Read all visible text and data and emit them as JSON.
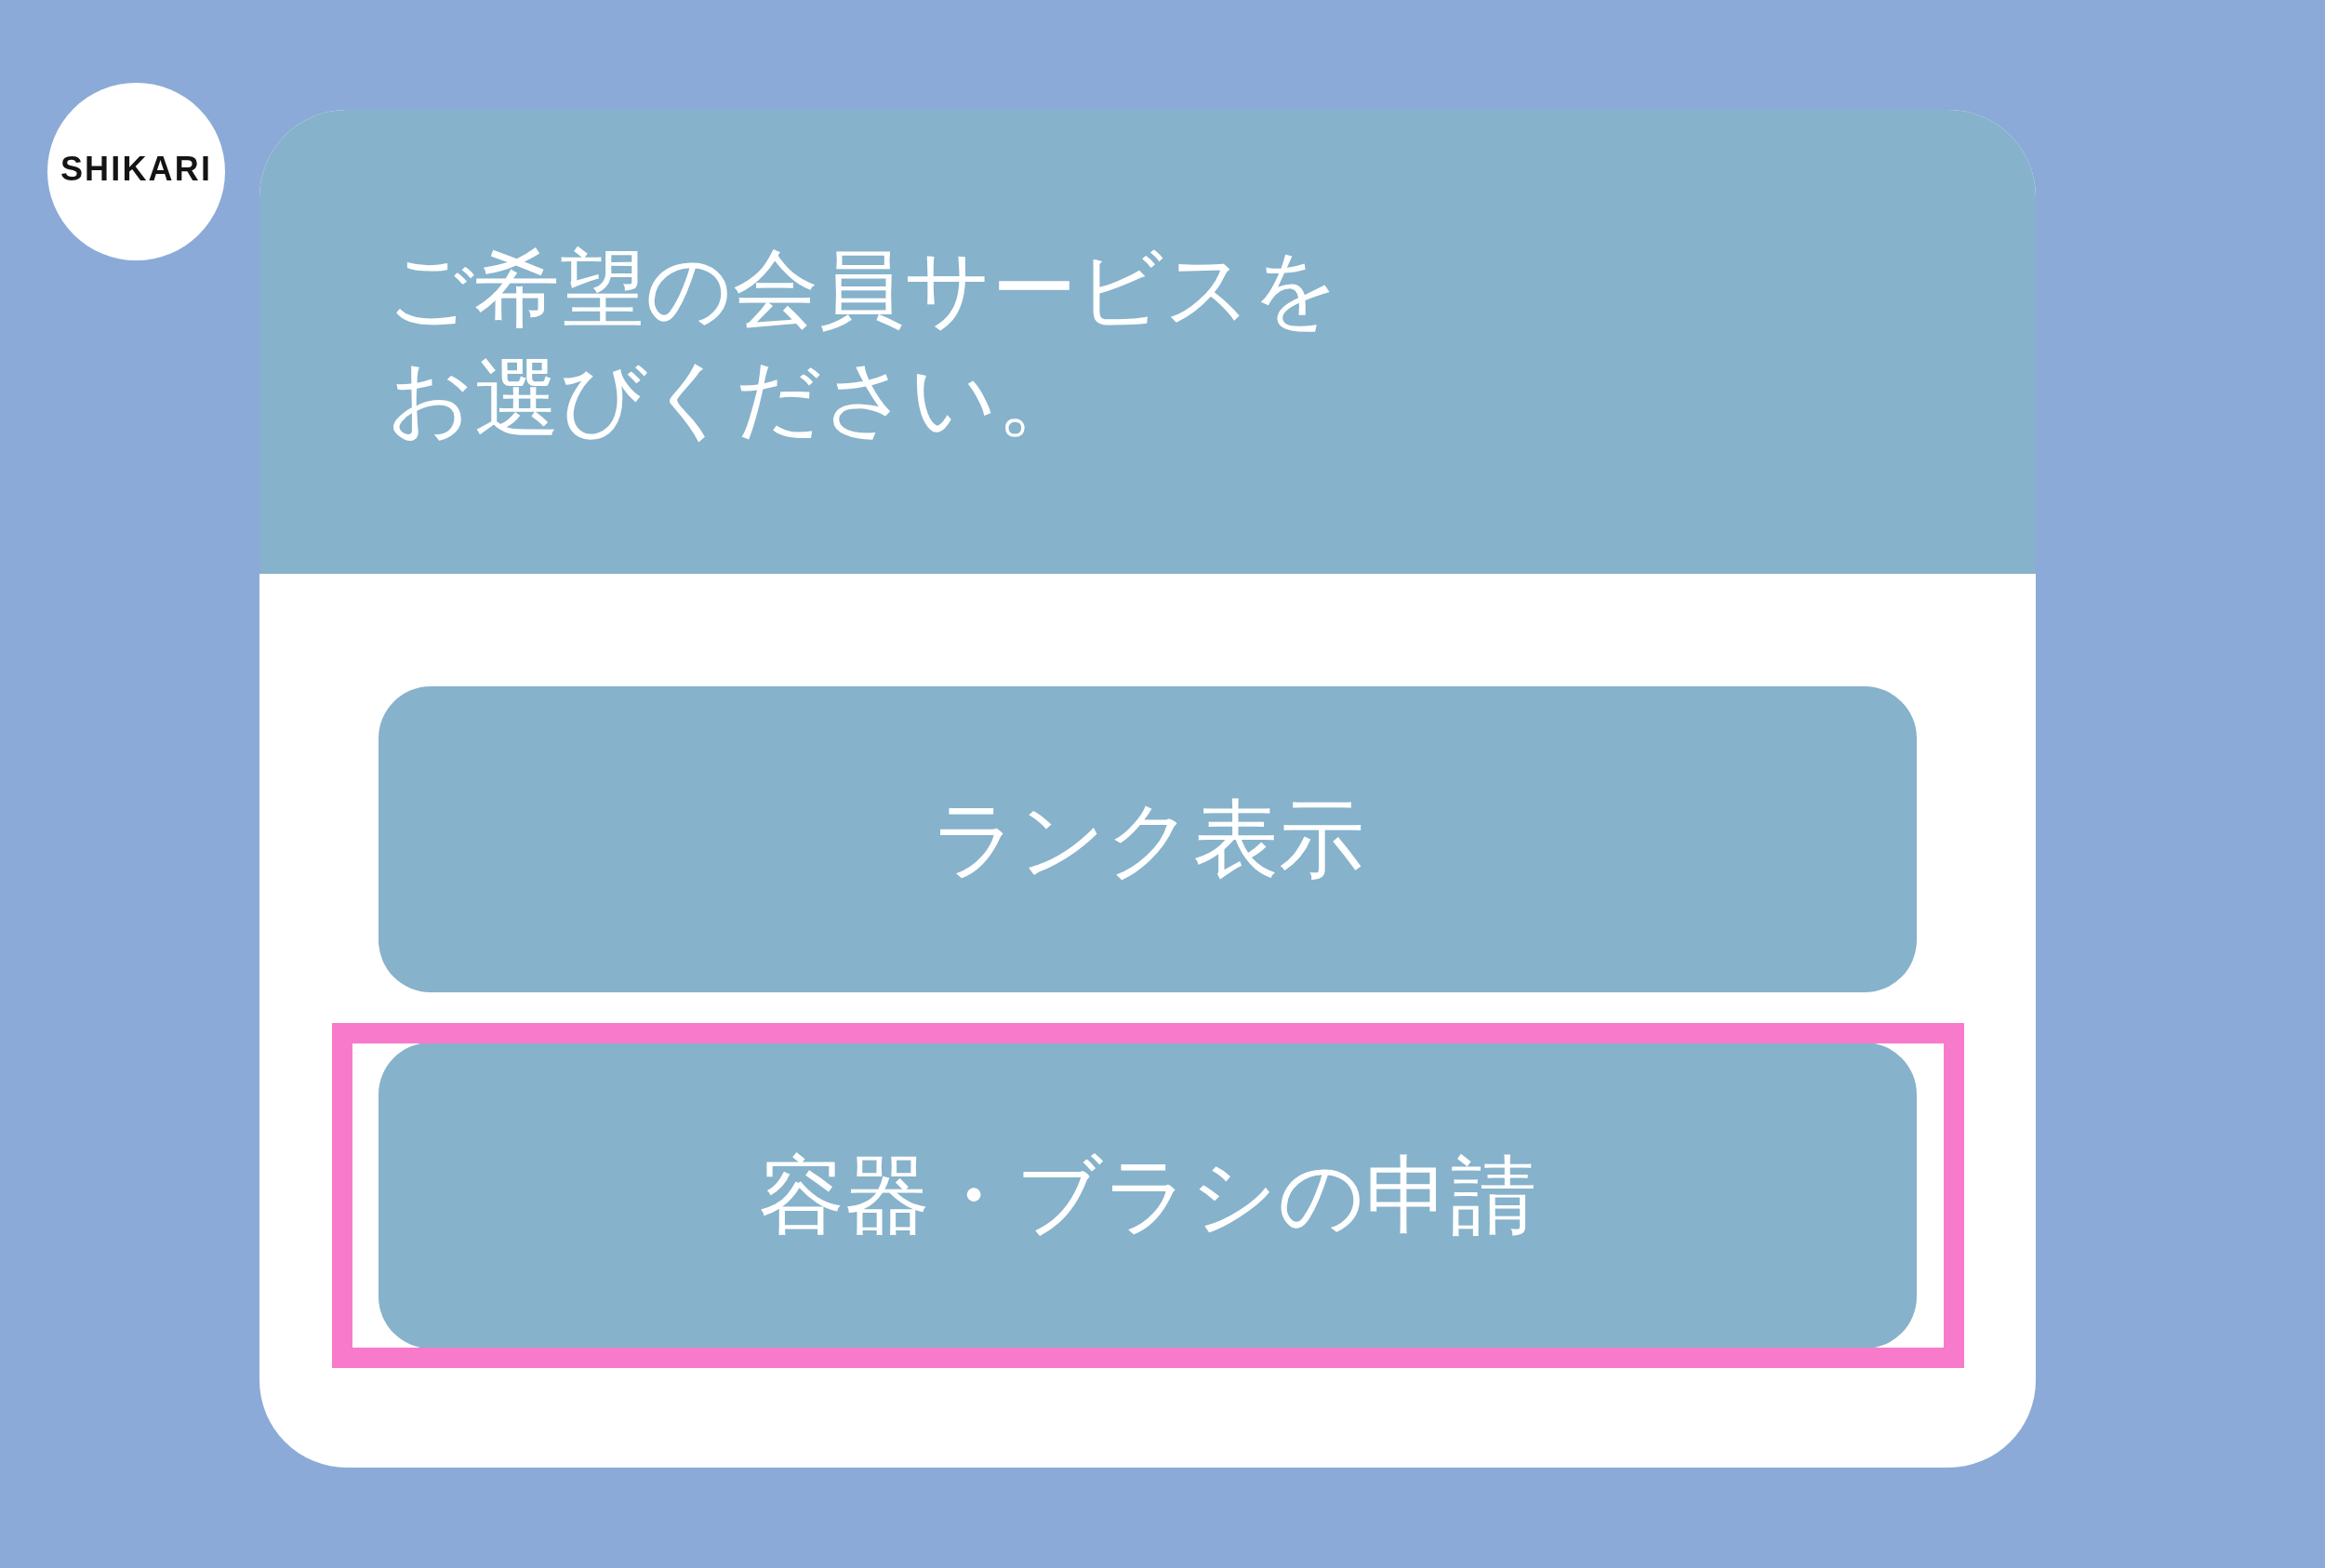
{
  "avatar": {
    "label": "SHIKARI"
  },
  "message": {
    "text": "ご希望の会員サービスをお選びください。"
  },
  "buttons": [
    {
      "label": "ランク表示",
      "highlighted": false
    },
    {
      "label": "容器・ブラシの申請",
      "highlighted": true
    }
  ]
}
